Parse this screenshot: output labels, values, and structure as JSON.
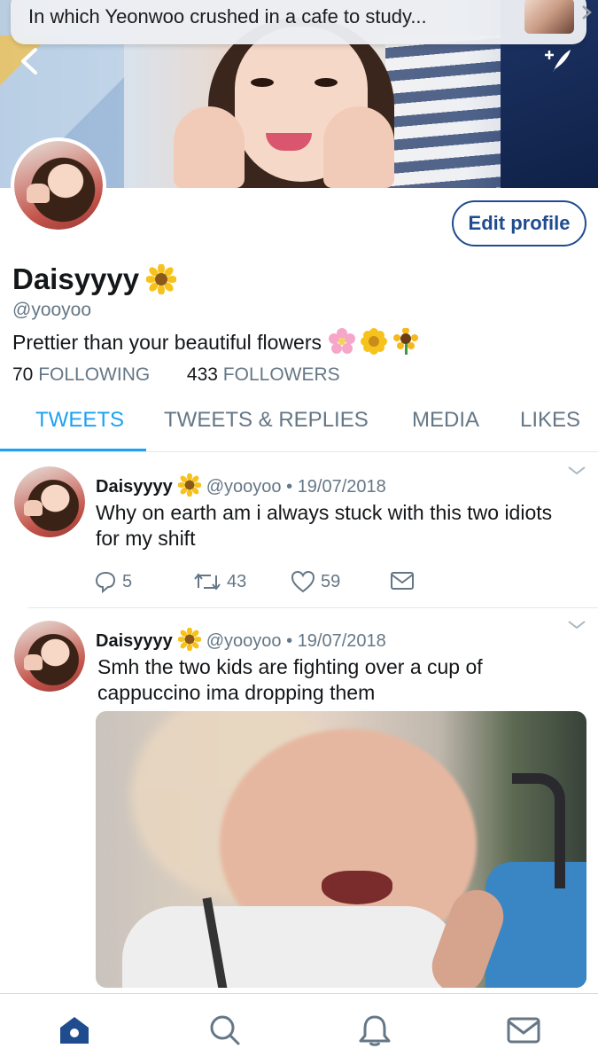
{
  "notification": {
    "text": "In which Yeonwoo crushed in a cafe to study...",
    "thumb_icon": "story-thumbnail"
  },
  "header": {
    "back_icon": "chevron-left-icon",
    "compose_icon": "compose-tweet-icon"
  },
  "profile": {
    "name": "Daisyyyy",
    "name_emoji": "sunflower",
    "handle": "@yooyoo",
    "bio": "Prettier than your beautiful flowers",
    "bio_emojis": [
      "cherry-blossom",
      "blossom",
      "sunflower"
    ],
    "edit_button": "Edit profile",
    "following_count": "70",
    "following_label": "FOLLOWING",
    "followers_count": "433",
    "followers_label": "FOLLOWERS"
  },
  "tabs": [
    {
      "label": "TWEETS",
      "active": true
    },
    {
      "label": "TWEETS & REPLIES",
      "active": false
    },
    {
      "label": "MEDIA",
      "active": false
    },
    {
      "label": "LIKES",
      "active": false
    }
  ],
  "tweets": [
    {
      "name": "Daisyyyy",
      "handle": "@yooyoo",
      "separator": "•",
      "date": "19/07/2018",
      "text": "Why on earth am i always stuck with this two idiots for my shift",
      "replies": "5",
      "retweets": "43",
      "likes": "59"
    },
    {
      "name": "Daisyyyy",
      "handle": "@yooyoo",
      "separator": "•",
      "date": "19/07/2018",
      "text": "Smh the two kids are fighting over a cup of cappuccino ima dropping them",
      "has_media": true
    }
  ],
  "bottom_nav": [
    {
      "icon": "home-icon",
      "active": true
    },
    {
      "icon": "search-icon",
      "active": false
    },
    {
      "icon": "notifications-icon",
      "active": false
    },
    {
      "icon": "messages-icon",
      "active": false
    }
  ],
  "colors": {
    "accent": "#1da1f2",
    "edit_button": "#1f4b8f",
    "muted": "#657786",
    "nav_active": "#1f4b8f"
  }
}
